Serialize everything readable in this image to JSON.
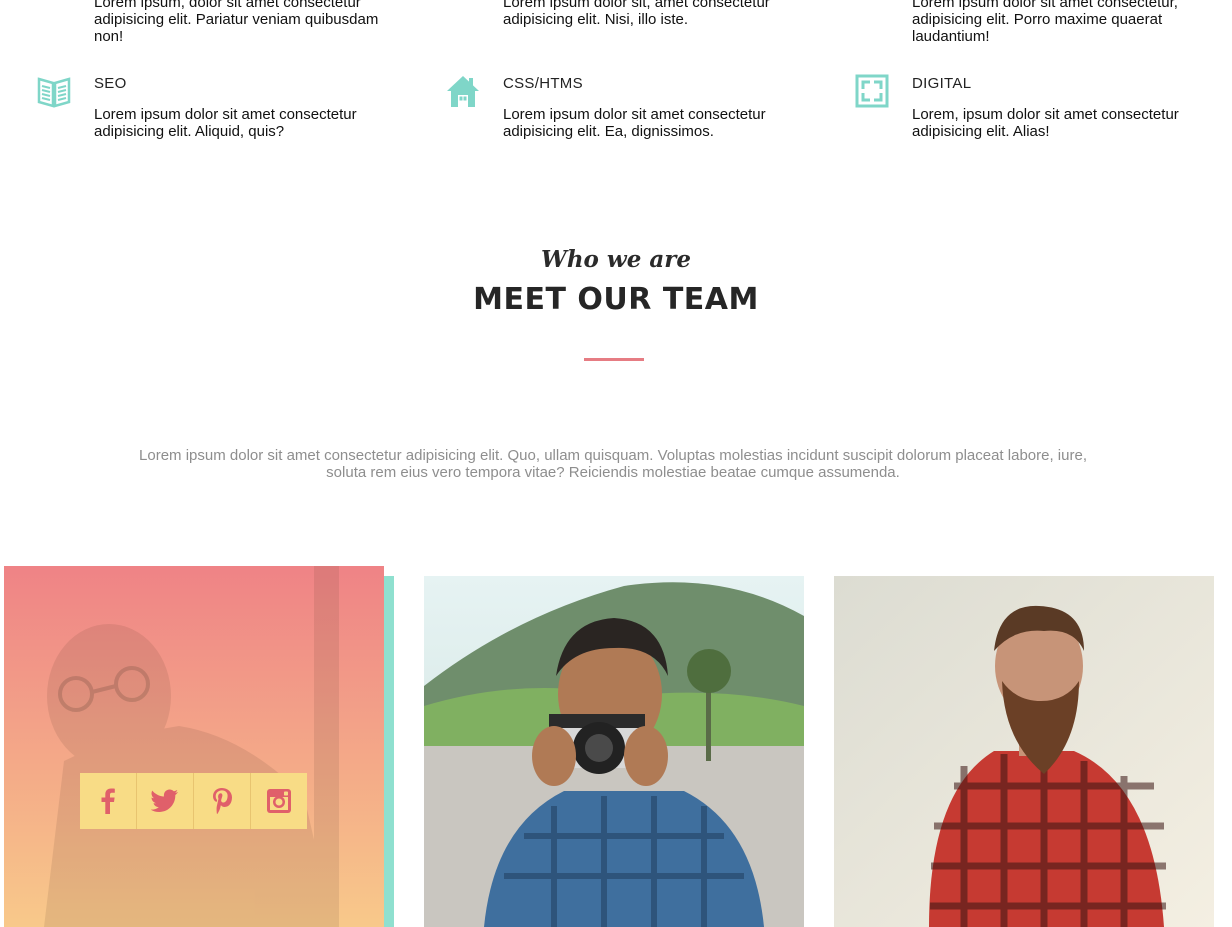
{
  "services_top": [
    {
      "line1": "Lorem ipsum, dolor sit amet consectetur",
      "line2": "adipisicing elit. Pariatur veniam quibusdam",
      "line3": "non!"
    },
    {
      "line1": "Lorem ipsum dolor sit, amet consectetur",
      "line2": "adipisicing elit. Nisi, illo iste.",
      "line3": ""
    },
    {
      "line1": "Lorem ipsum dolor sit amet consectetur,",
      "line2": "adipisicing elit. Porro maxime quaerat",
      "line3": "laudantium!"
    }
  ],
  "services": [
    {
      "title": "SEO",
      "icon": "book-icon",
      "line1": "Lorem ipsum dolor sit amet consectetur",
      "line2": "adipisicing elit. Aliquid, quis?"
    },
    {
      "title": "CSS/HTMS",
      "icon": "house-icon",
      "line1": "Lorem ipsum dolor sit amet consectetur",
      "line2": "adipisicing elit. Ea, dignissimos."
    },
    {
      "title": "DIGITAL",
      "icon": "fullscreen-icon",
      "line1": "Lorem, ipsum dolor sit amet consectetur",
      "line2": "adipisicing elit. Alias!"
    }
  ],
  "team_section": {
    "kicker": "Who we are",
    "title": "MEET OUR TEAM",
    "intro_line1": "Lorem ipsum dolor sit amet consectetur adipisicing elit. Quo, ullam quisquam. Voluptas molestias incidunt suscipit dolorum placeat labore, iure,",
    "intro_line2": "soluta rem eius vero tempora vitae? Reiciendis molestiae beatae cumque assumenda."
  },
  "social_icons": [
    "facebook-icon",
    "twitter-icon",
    "pinterest-icon",
    "instagram-icon"
  ],
  "colors": {
    "accent_teal": "#7fd6c8",
    "divider_pink": "#e67c83",
    "overlay_top": "#ef8386",
    "overlay_bottom": "#f8c98a",
    "social_bg": "#f8dc86",
    "social_icon": "#e0606a"
  }
}
